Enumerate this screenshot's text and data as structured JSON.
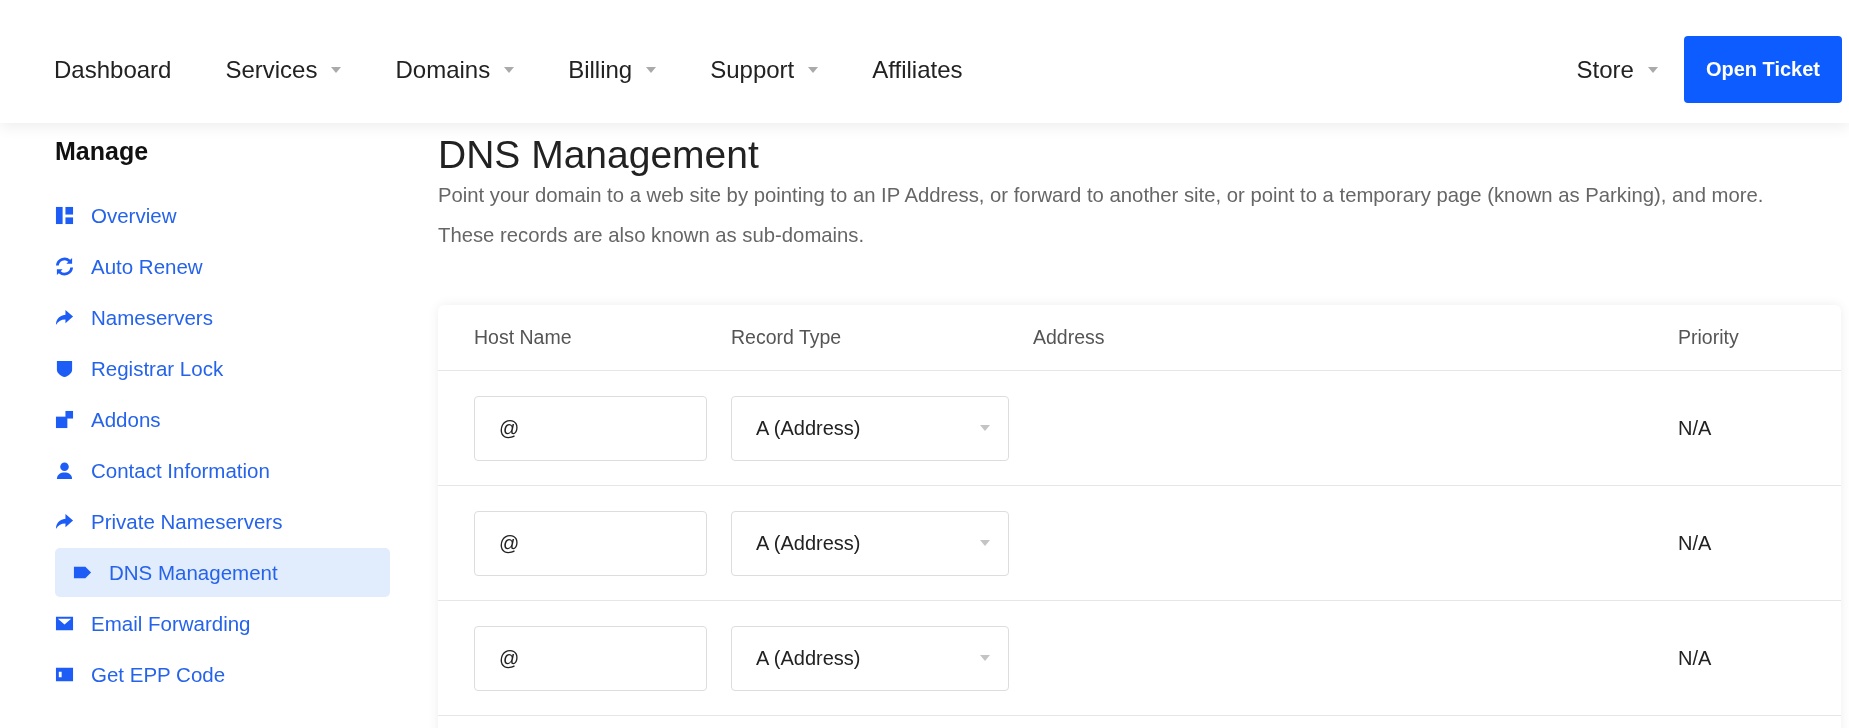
{
  "nav": {
    "items": [
      {
        "label": "Dashboard",
        "dropdown": false
      },
      {
        "label": "Services",
        "dropdown": true
      },
      {
        "label": "Domains",
        "dropdown": true
      },
      {
        "label": "Billing",
        "dropdown": true
      },
      {
        "label": "Support",
        "dropdown": true
      },
      {
        "label": "Affiliates",
        "dropdown": false
      }
    ],
    "right_items": [
      {
        "label": "Store",
        "dropdown": true
      }
    ],
    "button": "Open Ticket"
  },
  "sidebar": {
    "title": "Manage",
    "items": [
      {
        "label": "Overview",
        "kind": "dashboard",
        "selected": false
      },
      {
        "label": "Auto Renew",
        "kind": "sync",
        "selected": false
      },
      {
        "label": "Nameservers",
        "kind": "share",
        "selected": false
      },
      {
        "label": "Registrar Lock",
        "kind": "shield",
        "selected": false
      },
      {
        "label": "Addons",
        "kind": "addons",
        "selected": false
      },
      {
        "label": "Contact Information",
        "kind": "user",
        "selected": false
      },
      {
        "label": "Private Nameservers",
        "kind": "share",
        "selected": false
      },
      {
        "label": "DNS Management",
        "kind": "tag",
        "selected": true
      },
      {
        "label": "Email Forwarding",
        "kind": "envelope",
        "selected": false
      },
      {
        "label": "Get EPP Code",
        "kind": "card",
        "selected": false
      }
    ]
  },
  "main": {
    "title": "DNS Management",
    "description": [
      "Point your domain to a web site by pointing to an IP Address, or forward to another site, or point to a temporary page (known as Parking), and more.",
      "These records are also known as sub-domains."
    ],
    "table": {
      "columns": [
        "Host Name",
        "Record Type",
        "Address",
        "Priority"
      ],
      "rows": [
        {
          "host_name": "@",
          "record_type": "A (Address)",
          "priority": "N/A"
        },
        {
          "host_name": "@",
          "record_type": "A (Address)",
          "priority": "N/A"
        },
        {
          "host_name": "@",
          "record_type": "A (Address)",
          "priority": "N/A"
        }
      ]
    }
  }
}
